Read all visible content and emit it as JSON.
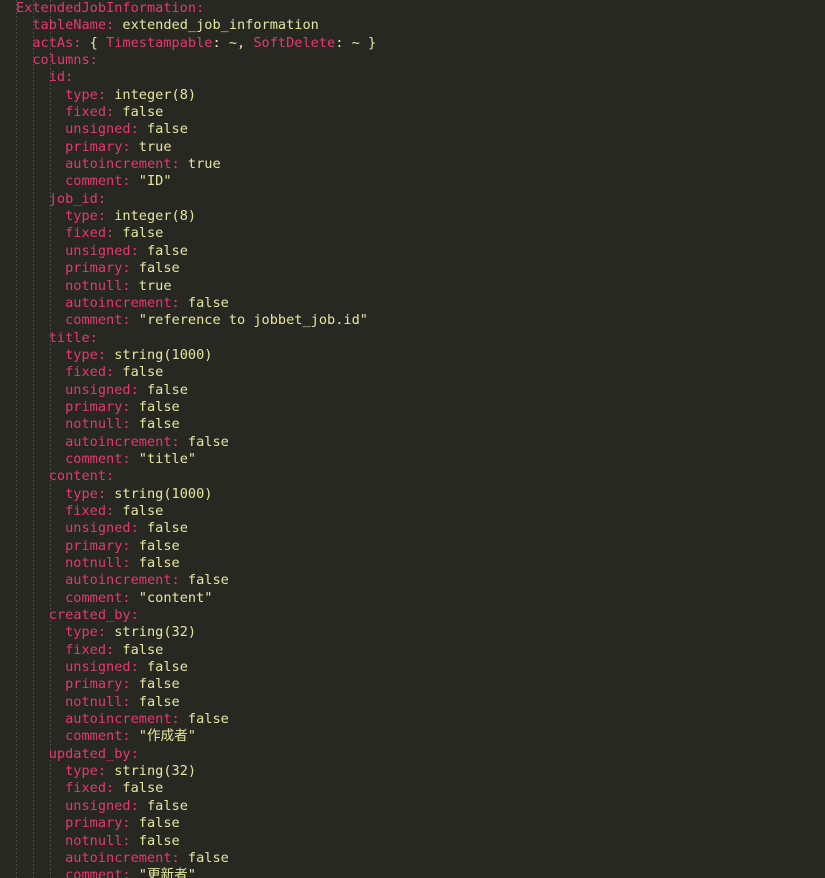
{
  "editor": {
    "theme": "monokai",
    "background": "#272822",
    "key_color": "#e6386f",
    "value_color": "#e6e6a0",
    "indent_guide_color": "#7d7d73",
    "font_size_px": 13.6,
    "line_height_px": 17.35,
    "language": "yaml"
  },
  "document": {
    "root_key": "ExtendedJobInformation",
    "lines": [
      {
        "indent": 0,
        "key": "ExtendedJobInformation",
        "sep": ":",
        "value": ""
      },
      {
        "indent": 1,
        "key": "tableName",
        "sep": ": ",
        "value": "extended_job_information"
      },
      {
        "indent": 1,
        "key": "actAs",
        "sep": ": ",
        "value": "",
        "inline": [
          {
            "t": "p",
            "s": "{ "
          },
          {
            "t": "k",
            "s": "Timestampable"
          },
          {
            "t": "p",
            "s": ": ~, "
          },
          {
            "t": "k",
            "s": "SoftDelete"
          },
          {
            "t": "p",
            "s": ": ~ }"
          }
        ]
      },
      {
        "indent": 1,
        "key": "columns",
        "sep": ":",
        "value": ""
      },
      {
        "indent": 2,
        "key": "id",
        "sep": ":",
        "value": ""
      },
      {
        "indent": 3,
        "key": "type",
        "sep": ": ",
        "value": "integer(8)"
      },
      {
        "indent": 3,
        "key": "fixed",
        "sep": ": ",
        "value": "false"
      },
      {
        "indent": 3,
        "key": "unsigned",
        "sep": ": ",
        "value": "false"
      },
      {
        "indent": 3,
        "key": "primary",
        "sep": ": ",
        "value": "true"
      },
      {
        "indent": 3,
        "key": "autoincrement",
        "sep": ": ",
        "value": "true"
      },
      {
        "indent": 3,
        "key": "comment",
        "sep": ": ",
        "value": "\"ID\""
      },
      {
        "indent": 2,
        "key": "job_id",
        "sep": ":",
        "value": ""
      },
      {
        "indent": 3,
        "key": "type",
        "sep": ": ",
        "value": "integer(8)"
      },
      {
        "indent": 3,
        "key": "fixed",
        "sep": ": ",
        "value": "false"
      },
      {
        "indent": 3,
        "key": "unsigned",
        "sep": ": ",
        "value": "false"
      },
      {
        "indent": 3,
        "key": "primary",
        "sep": ": ",
        "value": "false"
      },
      {
        "indent": 3,
        "key": "notnull",
        "sep": ": ",
        "value": "true"
      },
      {
        "indent": 3,
        "key": "autoincrement",
        "sep": ": ",
        "value": "false"
      },
      {
        "indent": 3,
        "key": "comment",
        "sep": ": ",
        "value": "\"reference to jobbet_job.id\""
      },
      {
        "indent": 2,
        "key": "title",
        "sep": ":",
        "value": ""
      },
      {
        "indent": 3,
        "key": "type",
        "sep": ": ",
        "value": "string(1000)"
      },
      {
        "indent": 3,
        "key": "fixed",
        "sep": ": ",
        "value": "false"
      },
      {
        "indent": 3,
        "key": "unsigned",
        "sep": ": ",
        "value": "false"
      },
      {
        "indent": 3,
        "key": "primary",
        "sep": ": ",
        "value": "false"
      },
      {
        "indent": 3,
        "key": "notnull",
        "sep": ": ",
        "value": "false"
      },
      {
        "indent": 3,
        "key": "autoincrement",
        "sep": ": ",
        "value": "false"
      },
      {
        "indent": 3,
        "key": "comment",
        "sep": ": ",
        "value": "\"title\""
      },
      {
        "indent": 2,
        "key": "content",
        "sep": ":",
        "value": ""
      },
      {
        "indent": 3,
        "key": "type",
        "sep": ": ",
        "value": "string(1000)"
      },
      {
        "indent": 3,
        "key": "fixed",
        "sep": ": ",
        "value": "false"
      },
      {
        "indent": 3,
        "key": "unsigned",
        "sep": ": ",
        "value": "false"
      },
      {
        "indent": 3,
        "key": "primary",
        "sep": ": ",
        "value": "false"
      },
      {
        "indent": 3,
        "key": "notnull",
        "sep": ": ",
        "value": "false"
      },
      {
        "indent": 3,
        "key": "autoincrement",
        "sep": ": ",
        "value": "false"
      },
      {
        "indent": 3,
        "key": "comment",
        "sep": ": ",
        "value": "\"content\""
      },
      {
        "indent": 2,
        "key": "created_by",
        "sep": ":",
        "value": ""
      },
      {
        "indent": 3,
        "key": "type",
        "sep": ": ",
        "value": "string(32)"
      },
      {
        "indent": 3,
        "key": "fixed",
        "sep": ": ",
        "value": "false"
      },
      {
        "indent": 3,
        "key": "unsigned",
        "sep": ": ",
        "value": "false"
      },
      {
        "indent": 3,
        "key": "primary",
        "sep": ": ",
        "value": "false"
      },
      {
        "indent": 3,
        "key": "notnull",
        "sep": ": ",
        "value": "false"
      },
      {
        "indent": 3,
        "key": "autoincrement",
        "sep": ": ",
        "value": "false"
      },
      {
        "indent": 3,
        "key": "comment",
        "sep": ": ",
        "value": "\"作成者\""
      },
      {
        "indent": 2,
        "key": "updated_by",
        "sep": ":",
        "value": ""
      },
      {
        "indent": 3,
        "key": "type",
        "sep": ": ",
        "value": "string(32)"
      },
      {
        "indent": 3,
        "key": "fixed",
        "sep": ": ",
        "value": "false"
      },
      {
        "indent": 3,
        "key": "unsigned",
        "sep": ": ",
        "value": "false"
      },
      {
        "indent": 3,
        "key": "primary",
        "sep": ": ",
        "value": "false"
      },
      {
        "indent": 3,
        "key": "notnull",
        "sep": ": ",
        "value": "false"
      },
      {
        "indent": 3,
        "key": "autoincrement",
        "sep": ": ",
        "value": "false"
      },
      {
        "indent": 3,
        "key": "comment",
        "sep": ": ",
        "value": "\"更新者\""
      }
    ]
  },
  "indent_guides": {
    "x_positions": [
      16,
      33,
      50
    ]
  }
}
